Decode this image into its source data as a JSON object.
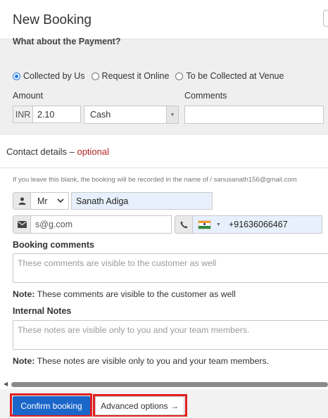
{
  "header": {
    "title": "New Booking"
  },
  "payment": {
    "heading": "What about the Payment?",
    "options": [
      {
        "label": "Collected by Us",
        "checked": true
      },
      {
        "label": "Request it Online",
        "checked": false
      },
      {
        "label": "To be Collected at Venue",
        "checked": false
      }
    ],
    "amount_label": "Amount",
    "comments_label": "Comments",
    "currency": "INR",
    "amount_value": "2.10",
    "method_value": "Cash",
    "comments_value": ""
  },
  "contact": {
    "title": "Contact details",
    "separator": " – ",
    "optional": "optional",
    "hint": "If you leave this blank, the booking will be recorded in the name of / sanusanath156@gmail.com",
    "salutation": "Mr",
    "name_value": "Sanath Adiga",
    "email_value": "s@g.com",
    "phone_value": "+91636066467"
  },
  "booking_comments": {
    "label": "Booking comments",
    "placeholder": "These comments are visible to the customer as well",
    "note_prefix": "Note:",
    "note_text": " These comments are visible to the customer as well"
  },
  "internal_notes": {
    "label": "Internal Notes",
    "placeholder": "These notes are visible only to you and your team members.",
    "note_prefix": "Note:",
    "note_text": " These notes are visible only to you and your team members."
  },
  "footer": {
    "confirm_label": "Confirm booking",
    "advanced_label": "Advanced options →"
  },
  "colors": {
    "primary": "#1a66c9",
    "optional_text": "#b22222",
    "highlight_outline": "#e02020",
    "autofill_bg": "#e8f0fe"
  },
  "icons": {
    "person": "person-icon",
    "mail": "envelope-icon",
    "phone": "phone-icon",
    "flag": "india-flag-icon"
  }
}
